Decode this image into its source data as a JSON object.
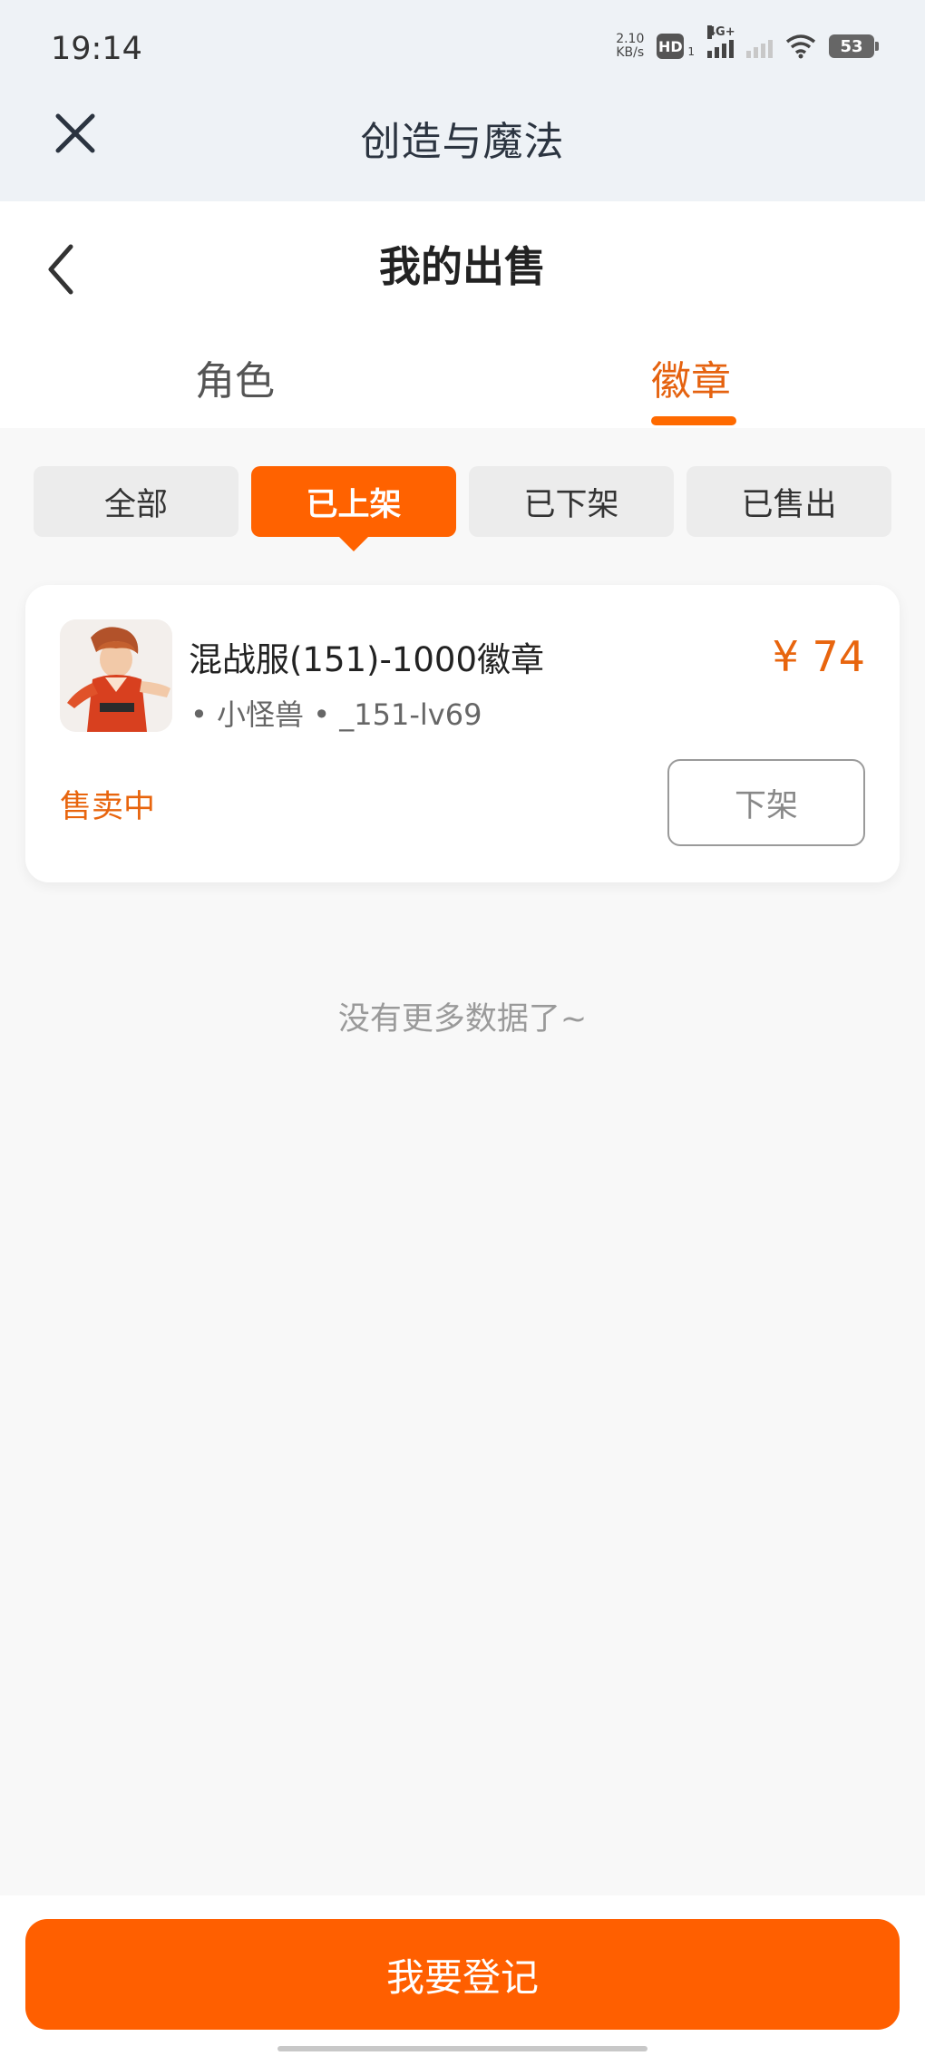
{
  "status_bar": {
    "time": "19:14",
    "net_speed_value": "2.10",
    "net_speed_unit": "KB/s",
    "hd_label": "HD",
    "hd_sub": "1",
    "network_type": "4G+",
    "battery": "53"
  },
  "app_header": {
    "title": "创造与魔法",
    "close_icon": "close-icon"
  },
  "page": {
    "title": "我的出售",
    "back_icon": "chevron-left-icon",
    "tabs": [
      {
        "label": "角色",
        "active": false
      },
      {
        "label": "徽章",
        "active": true
      }
    ]
  },
  "filters": [
    {
      "label": "全部",
      "active": false
    },
    {
      "label": "已上架",
      "active": true
    },
    {
      "label": "已下架",
      "active": false
    },
    {
      "label": "已售出",
      "active": false
    }
  ],
  "listing": {
    "title": "混战服(151)-1000徽章",
    "subtitle": "• 小怪兽 • _151-lv69",
    "price": "¥ 74",
    "status": "售卖中",
    "delist_label": "下架"
  },
  "list_end_text": "没有更多数据了~",
  "bottom": {
    "register_label": "我要登记"
  },
  "colors": {
    "accent": "#ff6200",
    "price": "#e8650e",
    "header_bg": "#eef2f6"
  }
}
